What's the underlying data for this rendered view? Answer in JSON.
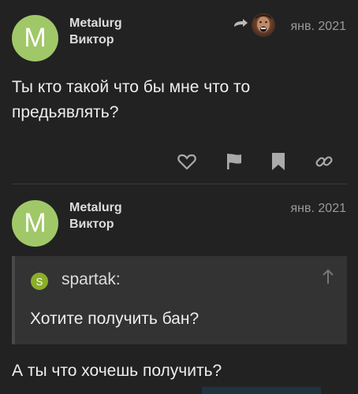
{
  "post1": {
    "avatar_letter": "M",
    "username": "Metalurg",
    "full_name": "Виктор",
    "date": "янв. 2021",
    "body_line1": "Ты кто такой что бы мне что то",
    "body_line2": "предьявлять?"
  },
  "actions": [
    "heart-icon",
    "flag-icon",
    "bookmark-icon",
    "link-icon"
  ],
  "post2": {
    "avatar_letter": "M",
    "username": "Metalurg",
    "full_name": "Виктор",
    "date": "янв. 2021",
    "quote": {
      "avatar_letter": "S",
      "username": "spartak:",
      "text": "Хотите получить бан?"
    },
    "body": "А ты что хочешь получить?"
  },
  "colors": {
    "background": "#222222",
    "avatar_green": "#a0c868",
    "quote_bg": "#333333",
    "quote_avatar": "#8bae2a"
  }
}
